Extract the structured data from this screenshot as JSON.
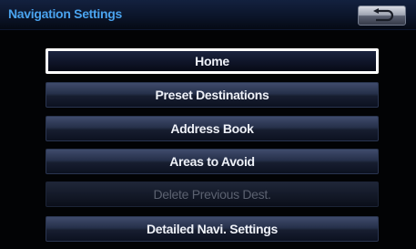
{
  "header": {
    "title": "Navigation Settings",
    "back_icon": "back-arrow-icon"
  },
  "menu": {
    "items": [
      {
        "label": "Home",
        "state": "selected"
      },
      {
        "label": "Preset Destinations",
        "state": "enabled"
      },
      {
        "label": "Address Book",
        "state": "enabled"
      },
      {
        "label": "Areas to Avoid",
        "state": "enabled"
      },
      {
        "label": "Delete Previous Dest.",
        "state": "disabled"
      },
      {
        "label": "Detailed Navi. Settings",
        "state": "enabled"
      }
    ]
  },
  "colors": {
    "title_text": "#4aa3ee",
    "button_text": "#eef1f8",
    "disabled_text": "#5b6170",
    "selected_border": "#ffffff",
    "background": "#020305"
  }
}
